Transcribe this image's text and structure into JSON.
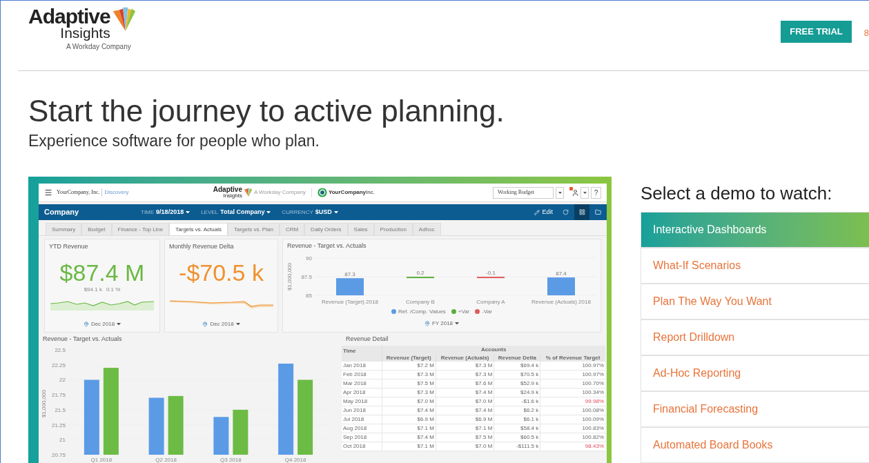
{
  "header": {
    "logo": {
      "name": "Adaptive",
      "subname": "Insights",
      "tagline": "A Workday Company"
    },
    "free_trial_button": "FREE TRIAL",
    "phone": "8"
  },
  "hero": {
    "title": "Start the journey to active planning.",
    "subtitle": "Experience software for people who plan."
  },
  "dashboard": {
    "topbar": {
      "company": "YourCompany, Inc.",
      "workspace": "Discovery",
      "logo_name": "Adaptive",
      "logo_subname": "Insights",
      "logo_tagline": "A Workday Company",
      "partner_logo": "**YourCompany**Inc.",
      "version_select": "Working Budget",
      "help": "?"
    },
    "filterbar": {
      "title": "Company",
      "filters": [
        {
          "label": "TIME",
          "value": "9/18/2018"
        },
        {
          "label": "LEVEL",
          "value": "Total Company"
        },
        {
          "label": "CURRENCY",
          "value": "$USD"
        }
      ],
      "edit": "Edit"
    },
    "tabs": [
      {
        "label": "Summary",
        "selected": false
      },
      {
        "label": "Budget",
        "selected": false
      },
      {
        "label": "Finance - Top Line",
        "selected": false
      },
      {
        "label": "Targets vs. Actuals",
        "selected": true
      },
      {
        "label": "Targets vs. Plan",
        "selected": false
      },
      {
        "label": "CRM",
        "selected": false
      },
      {
        "label": "Daily Orders",
        "selected": false
      },
      {
        "label": "Sales",
        "selected": false
      },
      {
        "label": "Production",
        "selected": false
      },
      {
        "label": "Adhoc",
        "selected": false
      }
    ],
    "kpis": [
      {
        "title": "YTD Revenue",
        "value": "$87.4 M",
        "color": "#6ab843",
        "details": [
          "$94.1 k",
          "0.1 %"
        ],
        "period": "Dec 2018"
      },
      {
        "title": "Monthly Revenue Delta",
        "value": "-$70.5 k",
        "color": "#f0912f",
        "period": "Dec 2018"
      }
    ],
    "waterfall": {
      "period": "FY 2018",
      "chart_data": {
        "type": "bar",
        "title": "Revenue - Target vs. Actuals",
        "ylabel": "$1,000,000",
        "categories": [
          "Revenue (Target) 2018",
          "Company B",
          "Company A",
          "Revenue (Actuals) 2018"
        ],
        "ylim": [
          85,
          90
        ],
        "yticks": [
          85,
          87.5,
          90
        ],
        "data_labels": true,
        "series": [
          {
            "name": "Ref. /Comp. Values",
            "color": "#5b9be6",
            "values": [
              87.3,
              null,
              null,
              87.4
            ]
          },
          {
            "name": "+Var",
            "color": "#5cad3c",
            "values": [
              null,
              null,
              null,
              null
            ]
          },
          {
            "name": "-Var",
            "color": "#e05a5a",
            "values": [
              null,
              null,
              null,
              null
            ]
          }
        ],
        "annotations": [
          "0.2",
          "-0.1"
        ]
      }
    },
    "quarterly": {
      "chart_data": {
        "type": "bar",
        "title": "Revenue - Target vs. Actuals",
        "ylabel": "$1,000,000",
        "categories": [
          "Q1 2018",
          "Q2 2018",
          "Q3 2018",
          "Q4 2018"
        ],
        "ylim": [
          20.75,
          22.5
        ],
        "yticks": [
          20.75,
          21,
          21.25,
          21.5,
          21.75,
          22,
          22.25,
          22.5
        ],
        "series": [
          {
            "color": "#5b9be6",
            "values": [
              22.0,
              21.7,
              21.38,
              22.27
            ]
          },
          {
            "color": "#6cbb45",
            "values": [
              22.2,
              21.73,
              21.5,
              22.0
            ]
          }
        ]
      }
    },
    "revenue_detail": {
      "title": "Revenue Detail",
      "group_header": "Accounts",
      "columns": [
        "Time",
        "Revenue (Target)",
        "Revenue (Actuals)",
        "Revenue Delta",
        "% of Revenue Target"
      ],
      "rows": [
        {
          "cells": [
            "Jan 2018",
            "$7.2 M",
            "$7.3 M",
            "$69.4 k",
            "100.97%"
          ],
          "negative": false
        },
        {
          "cells": [
            "Feb 2018",
            "$7.3 M",
            "$7.3 M",
            "$70.5 k",
            "100.97%"
          ],
          "negative": false
        },
        {
          "cells": [
            "Mar 2018",
            "$7.5 M",
            "$7.6 M",
            "$52.9 k",
            "100.70%"
          ],
          "negative": false
        },
        {
          "cells": [
            "Apr 2018",
            "$7.3 M",
            "$7.4 M",
            "$24.9 k",
            "100.34%"
          ],
          "negative": false
        },
        {
          "cells": [
            "May 2018",
            "$7.0 M",
            "$7.0 M",
            "-$1.6 k",
            "99.98%"
          ],
          "negative": true
        },
        {
          "cells": [
            "Jun 2018",
            "$7.4 M",
            "$7.4 M",
            "$6.2 k",
            "100.08%"
          ],
          "negative": false
        },
        {
          "cells": [
            "Jul 2018",
            "$6.9 M",
            "$6.9 M",
            "$6.1 k",
            "100.09%"
          ],
          "negative": false
        },
        {
          "cells": [
            "Aug 2018",
            "$7.1 M",
            "$7.1 M",
            "$58.4 k",
            "100.83%"
          ],
          "negative": false
        },
        {
          "cells": [
            "Sep 2018",
            "$7.4 M",
            "$7.5 M",
            "$60.5 k",
            "100.82%"
          ],
          "negative": false
        },
        {
          "cells": [
            "Oct 2018",
            "$7.1 M",
            "$7.0 M",
            "-$111.5 k",
            "98.43%"
          ],
          "negative": true
        }
      ]
    }
  },
  "demos": {
    "title": "Select a demo to watch:",
    "items": [
      {
        "label": "Interactive Dashboards",
        "selected": true
      },
      {
        "label": "What-If Scenarios",
        "selected": false
      },
      {
        "label": "Plan The Way You Want",
        "selected": false
      },
      {
        "label": "Report Drilldown",
        "selected": false
      },
      {
        "label": "Ad-Hoc Reporting",
        "selected": false
      },
      {
        "label": "Financial Forecasting",
        "selected": false
      },
      {
        "label": "Automated Board Books",
        "selected": false
      }
    ]
  }
}
